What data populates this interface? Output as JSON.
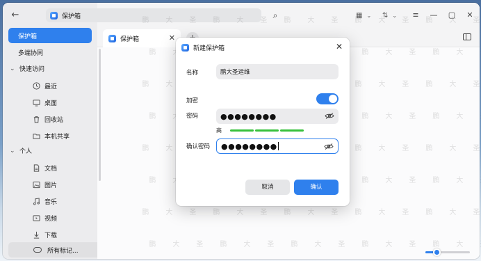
{
  "sidebar": {
    "items": [
      {
        "label": "保护箱",
        "active": true
      },
      {
        "label": "多端协同"
      }
    ],
    "groups": [
      {
        "label": "快速访问",
        "items": [
          {
            "label": "最近",
            "icon": "clock-icon"
          },
          {
            "label": "桌面",
            "icon": "desktop-icon"
          },
          {
            "label": "回收站",
            "icon": "trash-icon"
          },
          {
            "label": "本机共享",
            "icon": "folder-icon"
          }
        ]
      },
      {
        "label": "个人",
        "items": [
          {
            "label": "文档",
            "icon": "document-icon"
          },
          {
            "label": "图片",
            "icon": "image-icon"
          },
          {
            "label": "音乐",
            "icon": "music-icon"
          },
          {
            "label": "视频",
            "icon": "video-icon"
          },
          {
            "label": "下载",
            "icon": "download-icon"
          }
        ]
      }
    ],
    "tags_label": "所有标记..."
  },
  "address": {
    "label": "保护箱"
  },
  "tab": {
    "label": "保护箱"
  },
  "dialog": {
    "title": "新建保护箱",
    "name_label": "名称",
    "name_value": "鹏大圣运维",
    "encrypt_label": "加密",
    "encrypt_on": true,
    "password_label": "密码",
    "password_value": "●●●●●●●●",
    "strength_label": "高",
    "confirm_label": "确认密码",
    "confirm_value": "●●●●●●●●",
    "cancel_label": "取消",
    "ok_label": "确认"
  },
  "zoom_level": 0.25,
  "colors": {
    "accent": "#2f80ed",
    "strength": "#37c03b"
  },
  "watermark": [
    "鹏",
    "大",
    "圣"
  ]
}
